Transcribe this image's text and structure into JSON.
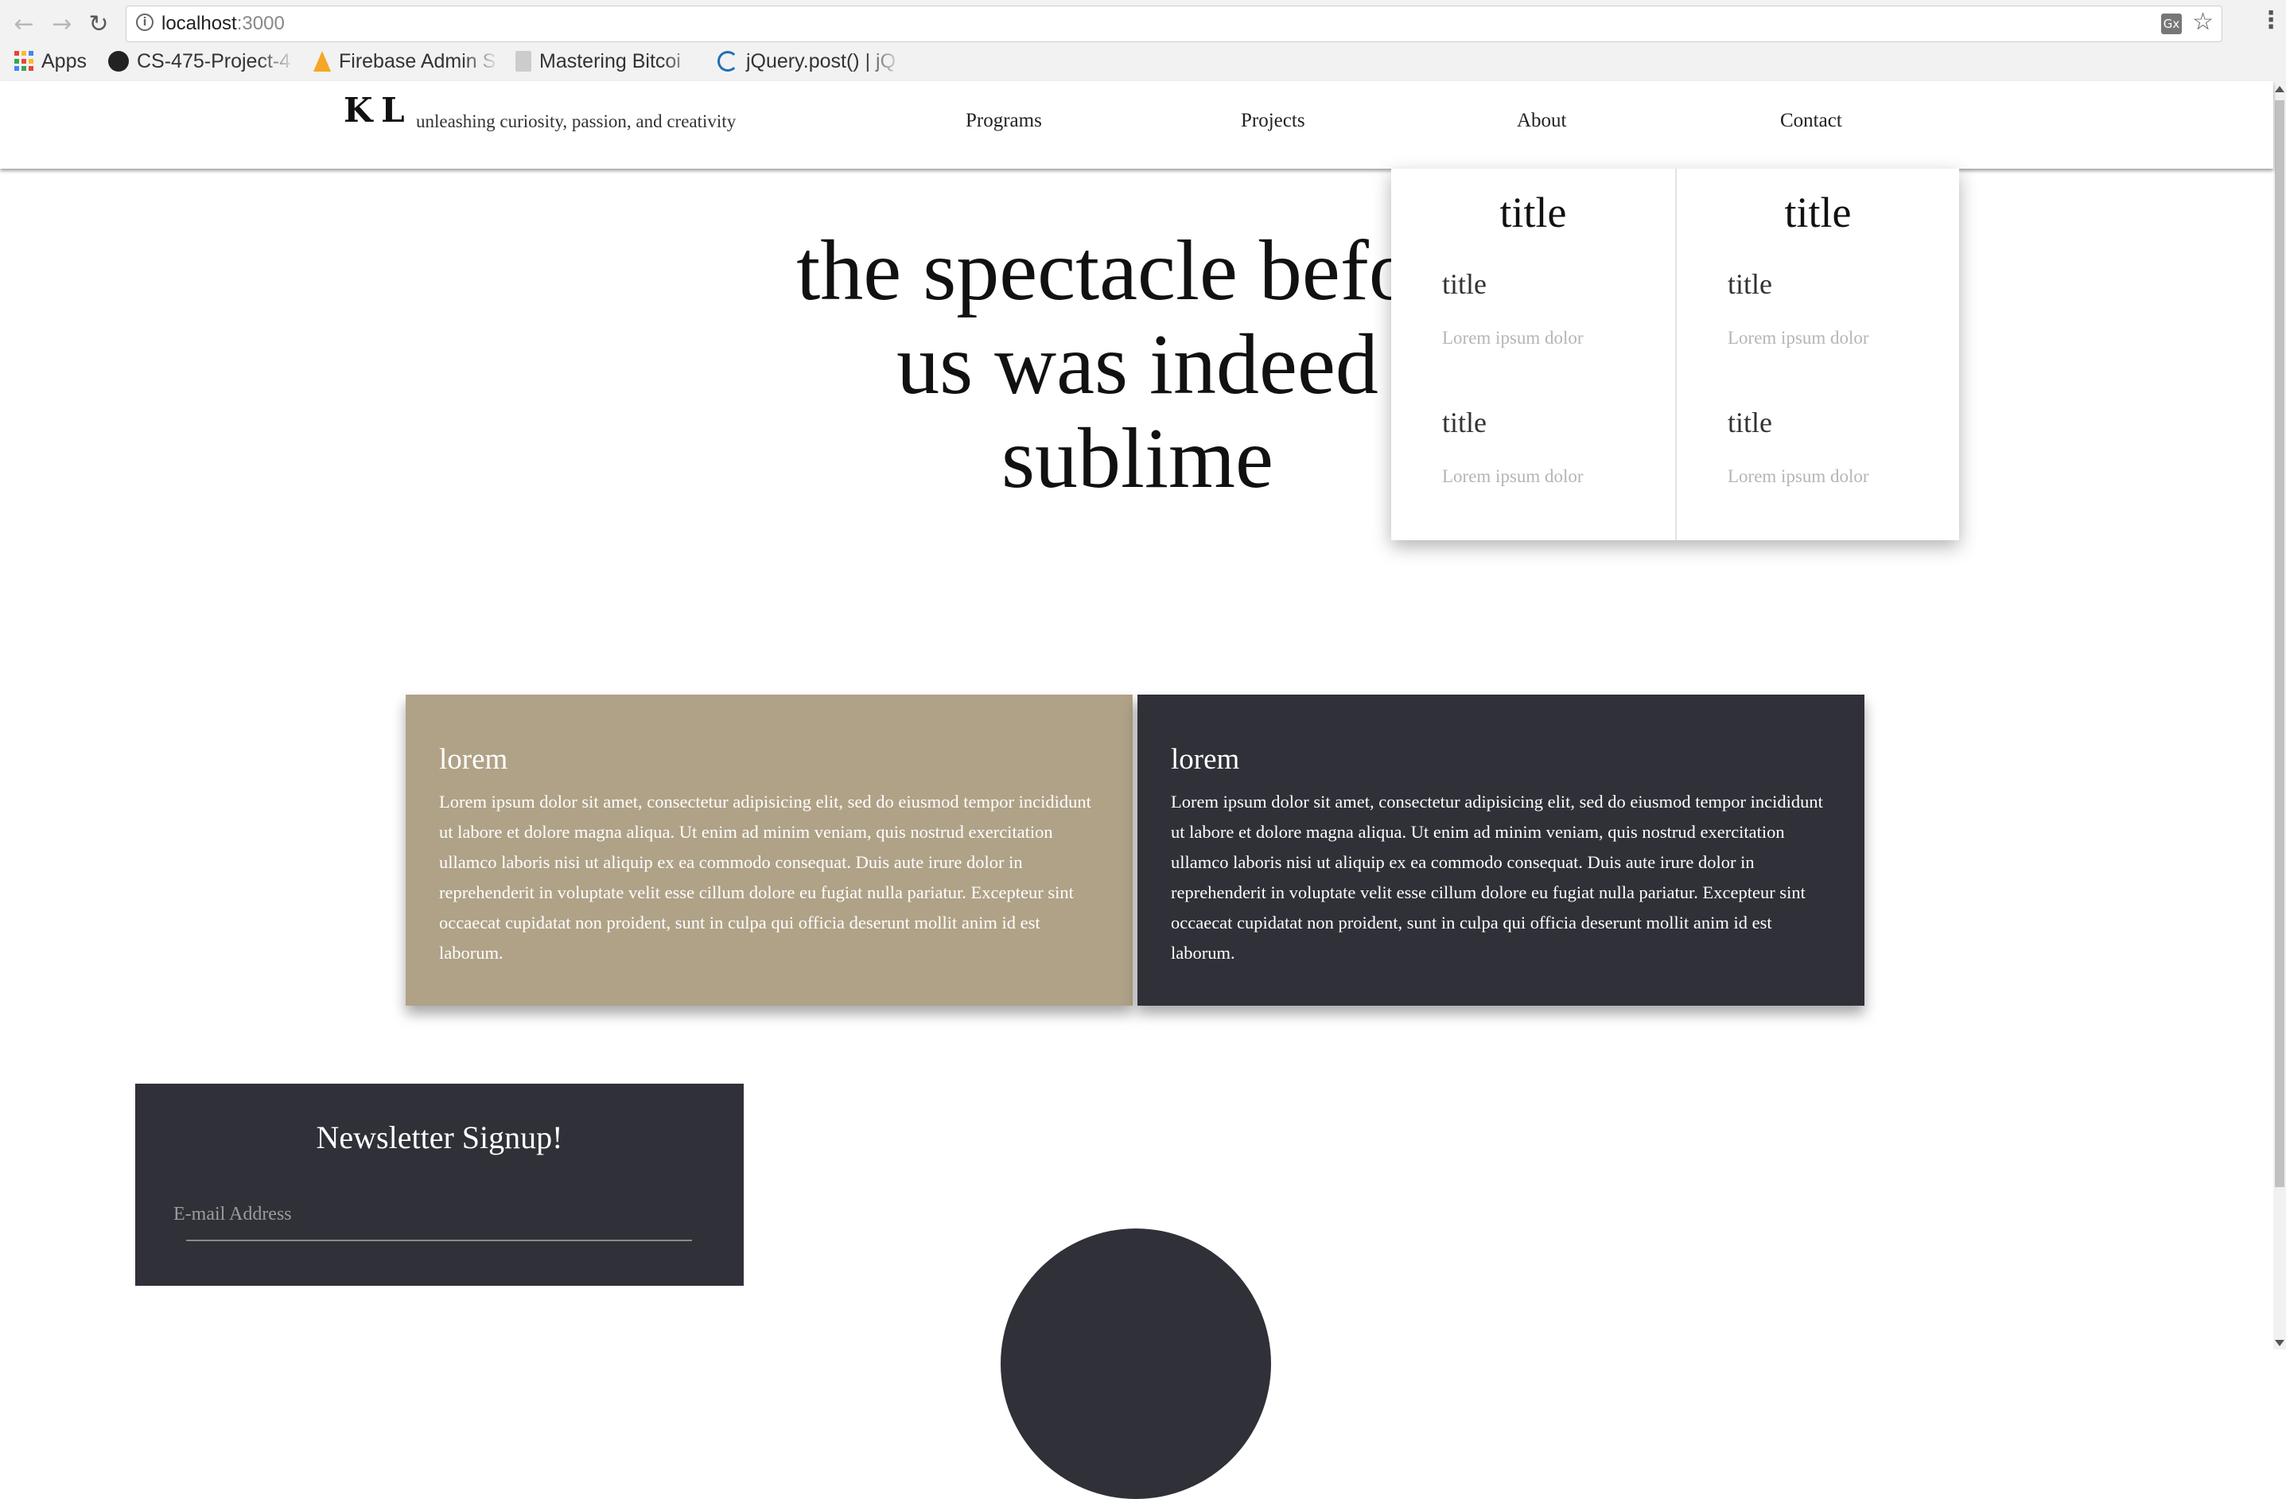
{
  "browser": {
    "url_host": "localhost",
    "url_port": ":3000",
    "bookmarks": [
      {
        "label": "Apps",
        "icon": "apps-grid-icon"
      },
      {
        "label": "CS-475-Project-4",
        "icon": "github-icon"
      },
      {
        "label": "Firebase Admin S",
        "icon": "firebase-icon"
      },
      {
        "label": "Mastering Bitcoi",
        "icon": "page-icon"
      },
      {
        "label": "jQuery.post() | jQ",
        "icon": "jquery-icon"
      }
    ],
    "translate_icon": "Gx"
  },
  "site": {
    "logo_text": "K L",
    "tagline": "unleashing curiosity, passion, and creativity",
    "nav": [
      "Programs",
      "Projects",
      "About",
      "Contact"
    ]
  },
  "hero": {
    "line1": "the spectacle before",
    "line2": "us was indeed",
    "line3": "sublime"
  },
  "dropdown": {
    "columns": [
      {
        "heading": "title",
        "items": [
          {
            "title": "title",
            "desc": "Lorem ipsum dolor"
          },
          {
            "title": "title",
            "desc": "Lorem ipsum dolor"
          }
        ]
      },
      {
        "heading": "title",
        "items": [
          {
            "title": "title",
            "desc": "Lorem ipsum dolor"
          },
          {
            "title": "title",
            "desc": "Lorem ipsum dolor"
          }
        ]
      }
    ]
  },
  "cards": [
    {
      "title": "lorem",
      "body": "Lorem ipsum dolor sit amet, consectetur adipisicing elit, sed do eiusmod tempor incididunt ut labore et dolore magna aliqua. Ut enim ad minim veniam, quis nostrud exercitation ullamco laboris nisi ut aliquip ex ea commodo consequat. Duis aute irure dolor in reprehenderit in voluptate velit esse cillum dolore eu fugiat nulla pariatur. Excepteur sint occaecat cupidatat non proident, sunt in culpa qui officia deserunt mollit anim id est laborum.",
      "color": "#b0a287"
    },
    {
      "title": "lorem",
      "body": "Lorem ipsum dolor sit amet, consectetur adipisicing elit, sed do eiusmod tempor incididunt ut labore et dolore magna aliqua. Ut enim ad minim veniam, quis nostrud exercitation ullamco laboris nisi ut aliquip ex ea commodo consequat. Duis aute irure dolor in reprehenderit in voluptate velit esse cillum dolore eu fugiat nulla pariatur. Excepteur sint occaecat cupidatat non proident, sunt in culpa qui officia deserunt mollit anim id est laborum.",
      "color": "#2f3038"
    }
  ],
  "newsletter": {
    "title": "Newsletter Signup!",
    "email_placeholder": "E-mail Address",
    "email_value": ""
  },
  "colors": {
    "tan": "#b0a287",
    "charcoal": "#2f3038"
  }
}
